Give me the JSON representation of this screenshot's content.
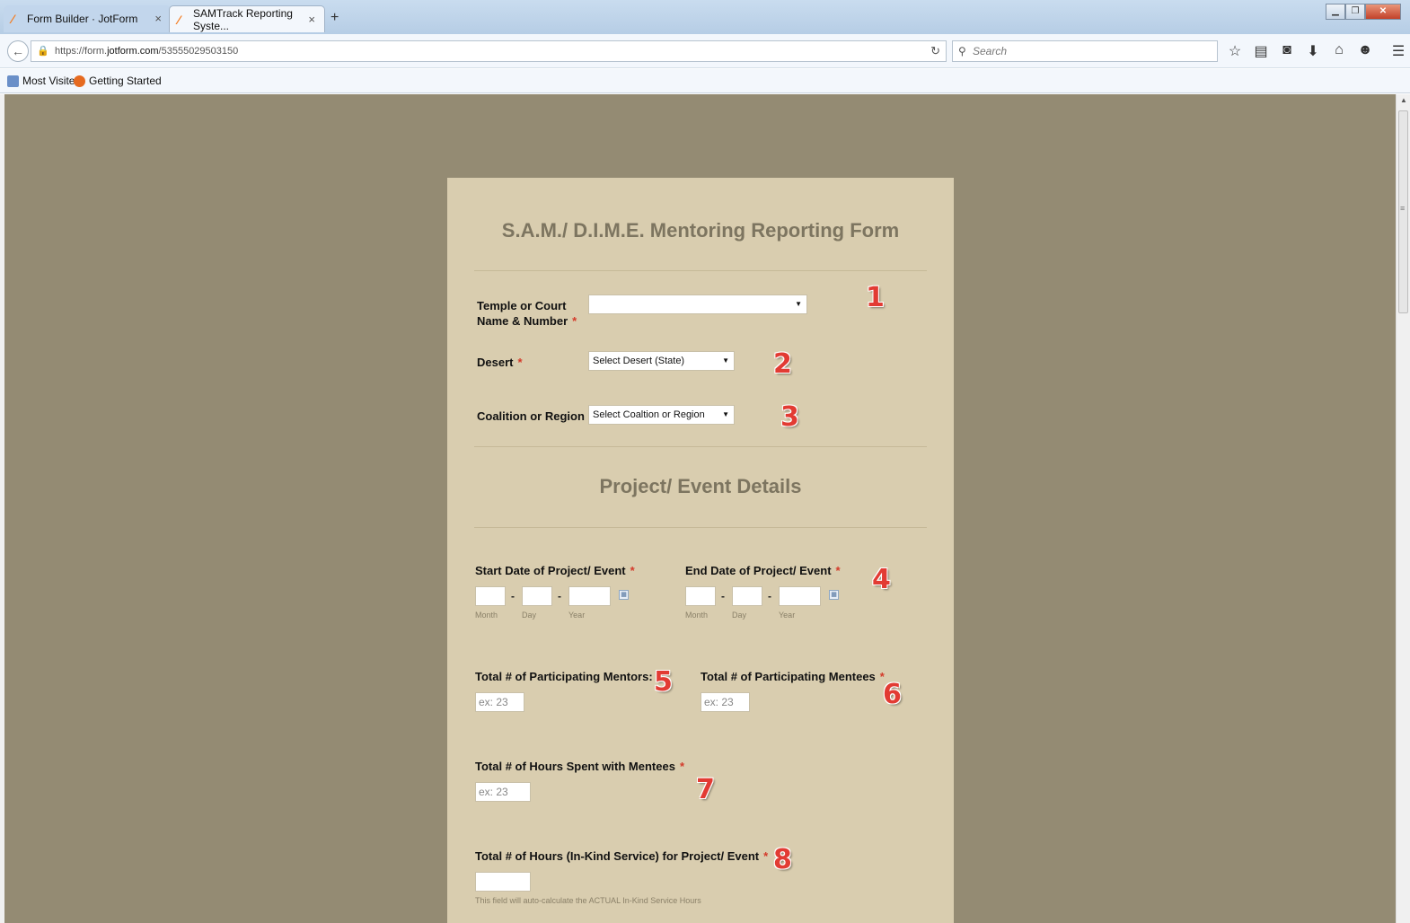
{
  "browser": {
    "tabs": [
      {
        "label": "Form Builder · JotForm",
        "active": false
      },
      {
        "label": "SAMTrack Reporting Syste...",
        "active": true
      }
    ],
    "url_prefix": "https://form.",
    "url_domain": "jotform.com",
    "url_path": "/53555029503150",
    "search_placeholder": "Search",
    "bookmarks": [
      "Most Visited",
      "Getting Started"
    ]
  },
  "form": {
    "title": "S.A.M./ D.I.M.E. Mentoring Reporting Form",
    "fields": {
      "temple_label_line1": "Temple or Court",
      "temple_label_line2": "Name & Number",
      "temple_value": "",
      "desert_label": "Desert",
      "desert_value": "Select Desert (State)",
      "coalition_label": "Coalition or Region",
      "coalition_value": "Select Coaltion or Region"
    },
    "section_title": "Project/ Event Details",
    "start_date_label": "Start Date of Project/ Event",
    "end_date_label": "End Date of Project/ Event",
    "date_sublabels": {
      "month": "Month",
      "day": "Day",
      "year": "Year"
    },
    "date_separator": "-",
    "mentors_label": "Total # of Participating Mentors:",
    "mentees_label": "Total # of Participating Mentees",
    "hours_label": "Total # of Hours Spent with Mentees",
    "inkind_label": "Total # of Hours (In-Kind Service) for Project/ Event",
    "inkind_help": "This field will auto-calculate the ACTUAL In-Kind Service Hours",
    "placeholder_number": "ex: 23",
    "required_mark": "*"
  },
  "annotations": [
    "1",
    "2",
    "3",
    "4",
    "5",
    "6",
    "7",
    "8"
  ],
  "colors": {
    "page_background": "#948b73",
    "form_background": "#d9cdaf",
    "title_color": "#7d7560",
    "required_color": "#d43a2a",
    "annotation_color": "#e23b33"
  }
}
